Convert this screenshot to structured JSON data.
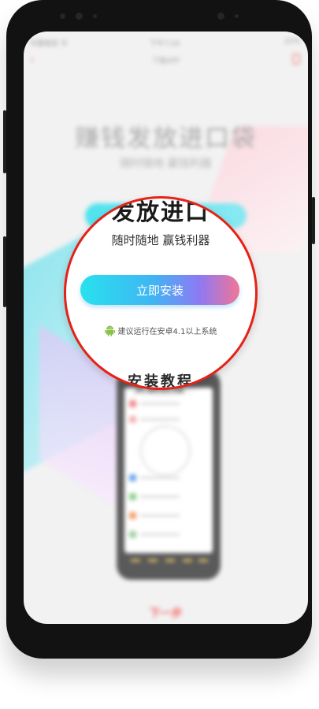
{
  "status_bar": {
    "carrier": "中国电信 令",
    "time": "下午7:24",
    "battery": "22%"
  },
  "nav_bar": {
    "title": "下载APP",
    "back_icon": "chevron-left-icon",
    "share_icon": "share-icon"
  },
  "hero": {
    "title": "赚钱发放进口袋",
    "subtitle": "随时随地 赢钱利器"
  },
  "magnifier": {
    "title_fragment": "发放进口",
    "subtitle": "随时随地 赢钱利器",
    "install_button": "立即安装",
    "note": "建议运行在安卓4.1以上系统",
    "note_icon": "android-icon",
    "bottom_fragment": "安装教程"
  },
  "tutorial": {
    "title": "安装教程"
  },
  "footer": {
    "next_label": "下一步"
  },
  "colors": {
    "accent_red": "#e62117",
    "button_start": "#28e1ee",
    "button_end": "#f17597",
    "android_green": "#8bc34a"
  }
}
